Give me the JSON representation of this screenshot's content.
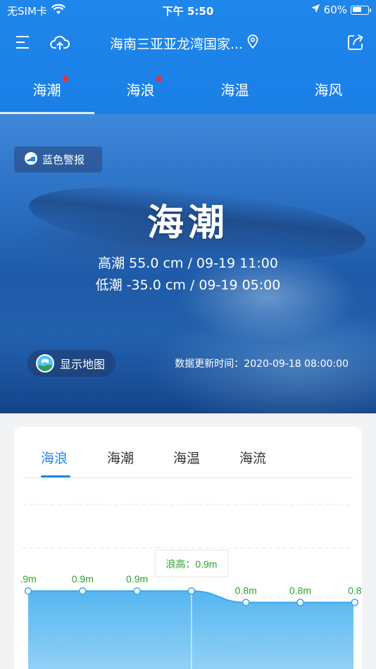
{
  "status_bar": {
    "carrier": "无SIM卡",
    "time": "下午 5:50",
    "battery": "60%",
    "battery_level": 0.6
  },
  "navbar": {
    "title": "海南三亚亚龙湾国家..."
  },
  "top_tabs": [
    {
      "label": "海潮",
      "active": true,
      "has_dot": true
    },
    {
      "label": "海浪",
      "active": false,
      "has_dot": true
    },
    {
      "label": "海温",
      "active": false,
      "has_dot": false
    },
    {
      "label": "海风",
      "active": false,
      "has_dot": false
    }
  ],
  "hero": {
    "alert_label": "蓝色警报",
    "title": "海潮",
    "high_tide": "高潮 55.0 cm / 09-19 11:00",
    "low_tide": "低潮 -35.0 cm / 09-19 05:00",
    "map_button": "显示地图",
    "update_time": "数据更新时间：2020-09-18 08:00:00"
  },
  "card": {
    "tabs": [
      {
        "label": "海浪",
        "active": true
      },
      {
        "label": "海潮",
        "active": false
      },
      {
        "label": "海温",
        "active": false
      },
      {
        "label": "海流",
        "active": false
      }
    ]
  },
  "colors": {
    "brand_blue": "#1f86ec",
    "alert_dot": "#ff2a2a",
    "chart_label_green": "#2aa32a",
    "chart_fill": "#4db2f0"
  },
  "chart_data": {
    "type": "area",
    "title": "",
    "xlabel": "",
    "ylabel": "",
    "series": [
      {
        "values": [
          0.9,
          0.9,
          0.9,
          0.9,
          0.8,
          0.8,
          0.8
        ]
      }
    ],
    "data_labels": [
      ".9m",
      "0.9m",
      "0.9m",
      "",
      "0.8m",
      "0.8m",
      "0.8"
    ],
    "ylim": [
      0,
      1.6
    ],
    "grid": true,
    "tooltip": {
      "index": 3,
      "text": "浪高：0.9m"
    }
  }
}
